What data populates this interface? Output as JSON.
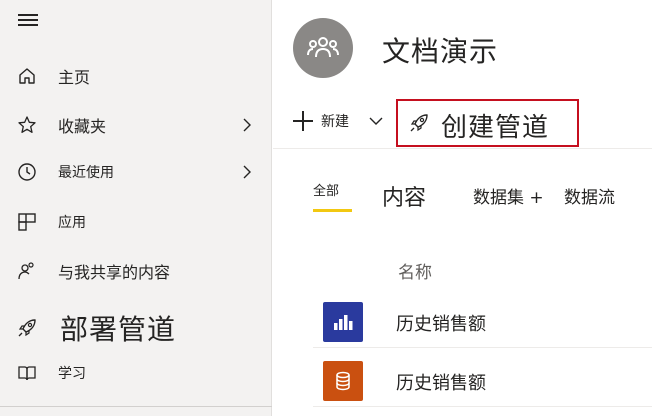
{
  "sidebar": {
    "items": [
      {
        "label": "主页",
        "icon": "home-icon"
      },
      {
        "label": "收藏夹",
        "icon": "star-icon"
      },
      {
        "label": "最近使用",
        "icon": "clock-icon"
      },
      {
        "label": "应用",
        "icon": "apps-icon"
      },
      {
        "label": "与我共享的内容",
        "icon": "shared-icon"
      },
      {
        "label": "部署管道",
        "icon": "rocket-icon"
      },
      {
        "label": "学习",
        "icon": "book-icon"
      }
    ]
  },
  "workspace": {
    "title": "文档演示",
    "avatar_icon": "group-icon"
  },
  "toolbar": {
    "new_label": "新建",
    "create_pipeline_label": "创建管道"
  },
  "tabs": {
    "all": "全部",
    "content": "内容",
    "datasets": "数据集 +",
    "dataflows": "数据流"
  },
  "list": {
    "name_header": "名称",
    "rows": [
      {
        "name": "历史销售额",
        "icon": "report-icon",
        "icon_color": "#2a3a9e"
      },
      {
        "name": "历史销售额",
        "icon": "dataset-icon",
        "icon_color": "#ca5010"
      }
    ]
  },
  "colors": {
    "sidebar_bg": "#f3f2f1",
    "tab_underline": "#f2c811",
    "highlight_border": "#c50f1f"
  }
}
